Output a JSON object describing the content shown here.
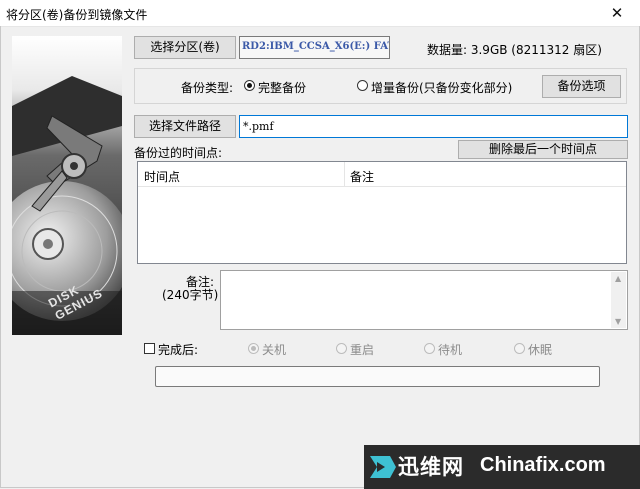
{
  "window": {
    "title": "将分区(卷)备份到镜像文件",
    "close_glyph": "✕"
  },
  "side_image": {
    "brand_text": "DISK GENIUS"
  },
  "source": {
    "select_button": "选择分区(卷)",
    "partition_value": "RD2:IBM_CCSA_X6(E:) FAT",
    "data_size": "数据量: 3.9GB (8211312 扇区)"
  },
  "backup_type": {
    "label": "备份类型:",
    "options": [
      "完整备份",
      "增量备份(只备份变化部分)"
    ],
    "selected": "完整备份",
    "options_button": "备份选项"
  },
  "file_path": {
    "button": "选择文件路径",
    "value": "*.pmf"
  },
  "timepoints": {
    "label": "备份过的时间点:",
    "delete_button": "删除最后一个时间点",
    "columns": [
      "时间点",
      "备注"
    ],
    "rows": []
  },
  "remark": {
    "label": "备注:",
    "sublabel": "(240字节)",
    "value": ""
  },
  "after_complete": {
    "label": "完成后:",
    "checked": false,
    "options": [
      "关机",
      "重启",
      "待机",
      "休眠"
    ],
    "selected": "关机"
  },
  "progress": {
    "value": 0
  },
  "watermark": {
    "brand": "迅维网",
    "site": "Chinafix.com",
    "accent": "#3ec1d3"
  }
}
